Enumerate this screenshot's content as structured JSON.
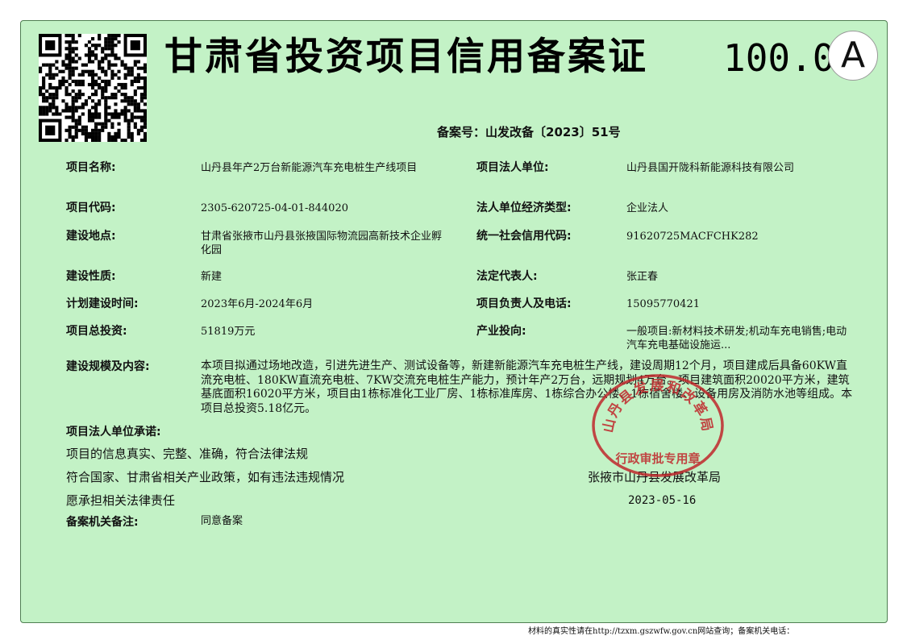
{
  "title": "甘肃省投资项目信用备案证",
  "score": "100.0",
  "grade": "A",
  "filing_number": "备案号：山发改备〔2023〕51号",
  "fields": {
    "project_name": {
      "label": "项目名称:",
      "value": "山丹县年产2万台新能源汽车充电桩生产线项目"
    },
    "legal_unit": {
      "label": "项目法人单位:",
      "value": "山丹县国开陇科新能源科技有限公司"
    },
    "project_code": {
      "label": "项目代码:",
      "value": "2305-620725-04-01-844020"
    },
    "econ_type": {
      "label": "法人单位经济类型:",
      "value": "企业法人"
    },
    "location": {
      "label": "建设地点:",
      "value": "甘肃省张掖市山丹县张掖国际物流园高新技术企业孵化园"
    },
    "credit_code": {
      "label": "统一社会信用代码:",
      "value": "91620725MACFCHK282"
    },
    "nature": {
      "label": "建设性质:",
      "value": "新建"
    },
    "legal_rep": {
      "label": "法定代表人:",
      "value": "张正春"
    },
    "period": {
      "label": "计划建设时间:",
      "value": "2023年6月-2024年6月"
    },
    "contact": {
      "label": "项目负责人及电话:",
      "value": "15095770421"
    },
    "investment": {
      "label": "项目总投资:",
      "value": "51819万元"
    },
    "industry": {
      "label": "产业投向:",
      "value": "一般项目:新材料技术研发;机动车充电销售;电动汽车充电基础设施运..."
    },
    "scale": {
      "label": "建设规模及内容:",
      "value": "本项目拟通过场地改造，引进先进生产、测试设备等，新建新能源汽车充电桩生产线，建设周期12个月，项目建成后具备60KW直流充电桩、180KW直流充电桩、7KW交流充电桩生产能力，预计年产2万台，远期规划4万台。项目建筑面积20020平方米，建筑基底面积16020平方米，项目由1栋标准化工业厂房、1栋标准库房、1栋综合办公楼、1栋宿舍楼、设备用房及消防水池等组成。本项目总投资5.18亿元。"
    }
  },
  "commitment": {
    "label": "项目法人单位承诺:",
    "line1": "项目的信息真实、完整、准确，符合法律法规",
    "line2": "符合国家、甘肃省相关产业政策，如有违法违规情况",
    "line3": "愿承担相关法律责任"
  },
  "authority": "张掖市山丹县发展改革局",
  "date": "2023-05-16",
  "remark": {
    "label": "备案机关备注:",
    "value": "同意备案"
  },
  "seal": {
    "ring_text": "山丹县发展和改革局",
    "bottom_text": "行政审批专用章",
    "color": "#c0282b"
  },
  "footer": "材料的真实性请在http://tzxm.gszwfw.gov.cn网站查询；备案机关电话：",
  "colors": {
    "background": "#c3f2c6",
    "border": "#4f7f52"
  }
}
